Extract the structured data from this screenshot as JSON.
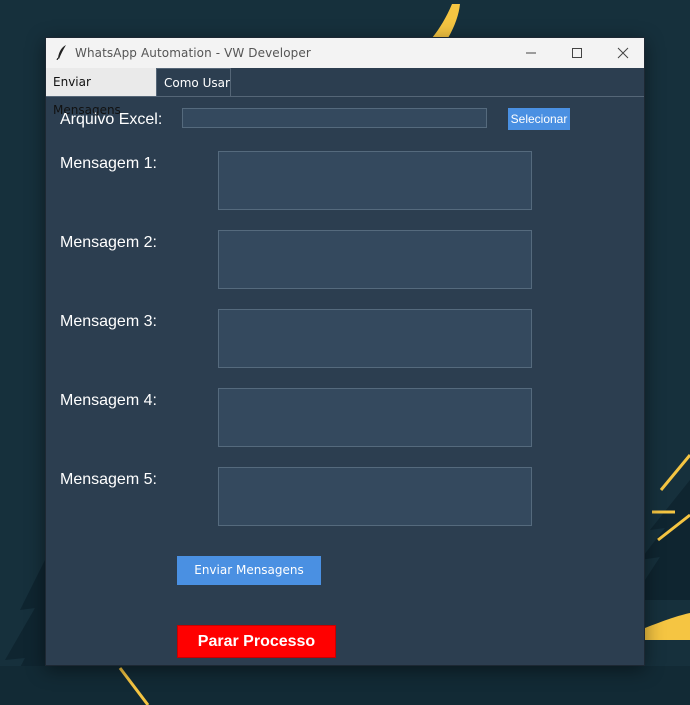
{
  "window": {
    "title": "WhatsApp Automation - VW Developer"
  },
  "tabs": [
    {
      "label": "Enviar Mensagens",
      "active": true
    },
    {
      "label": "Como Usar",
      "active": false
    }
  ],
  "form": {
    "excel_label": "Arquivo Excel:",
    "excel_value": "",
    "select_button": "Selecionar",
    "messages": [
      {
        "label": "Mensagem 1:",
        "value": ""
      },
      {
        "label": "Mensagem 2:",
        "value": ""
      },
      {
        "label": "Mensagem 3:",
        "value": ""
      },
      {
        "label": "Mensagem 4:",
        "value": ""
      },
      {
        "label": "Mensagem 5:",
        "value": ""
      }
    ],
    "send_button": "Enviar Mensagens",
    "stop_button": "Parar Processo"
  },
  "colors": {
    "panel_bg": "#2c3e50",
    "input_bg": "#34495e",
    "accent_blue": "#4a90e2",
    "stop_red": "#ff0000",
    "desktop_bg": "#16303c",
    "moon_yellow": "#f5c542"
  },
  "icons": {
    "app": "feather-icon",
    "minimize": "minimize-icon",
    "maximize": "maximize-icon",
    "close": "close-icon"
  }
}
